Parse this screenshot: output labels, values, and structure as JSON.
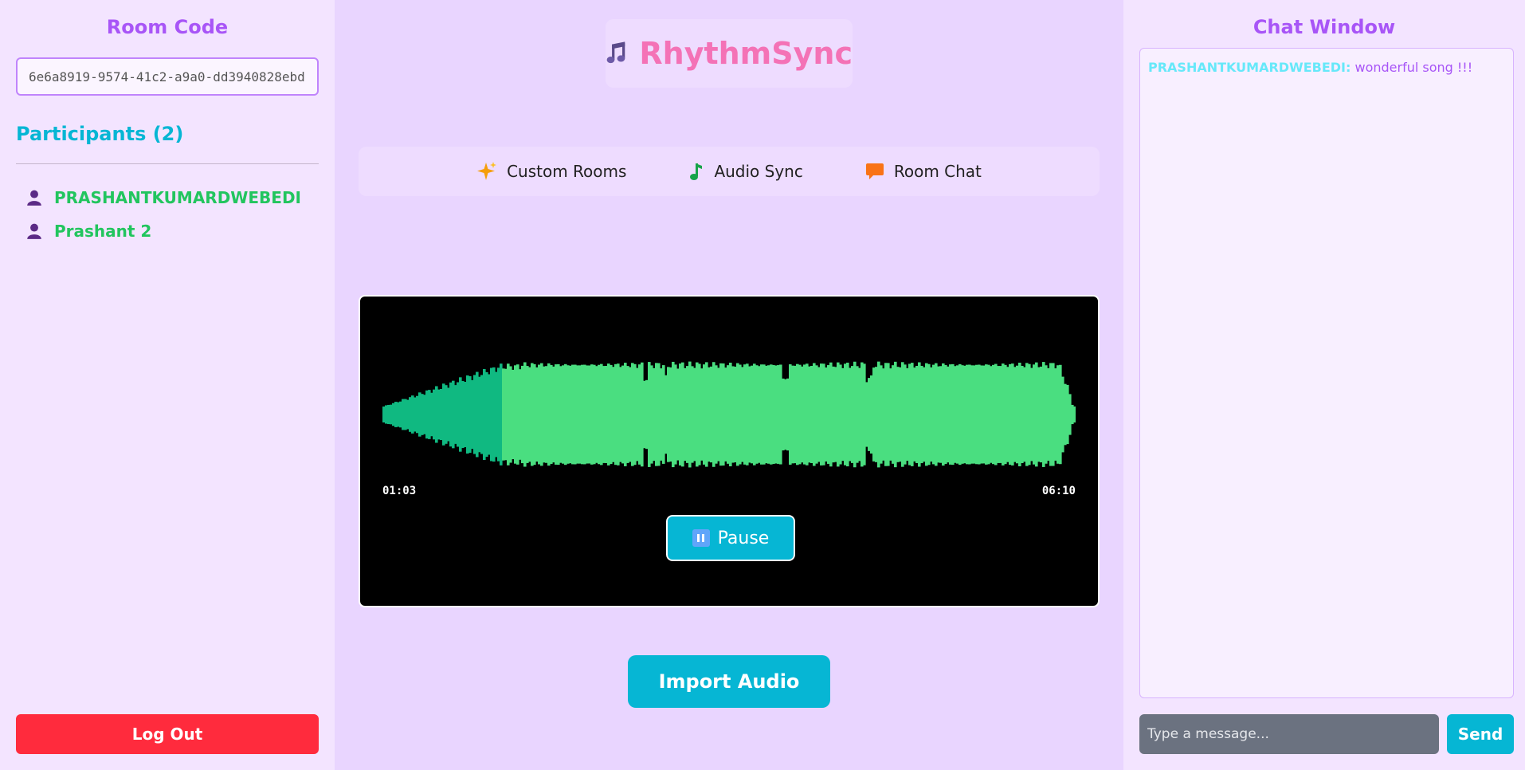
{
  "sidebar": {
    "room_code_title": "Room Code",
    "room_code_value": "6e6a8919-9574-41c2-a9a0-dd3940828ebd",
    "participants_title": "Participants (2)",
    "participants": [
      {
        "name": "PRASHANTKUMARDWEBEDI"
      },
      {
        "name": "Prashant 2"
      }
    ],
    "logout_label": "Log Out"
  },
  "header": {
    "brand": "RhythmSync",
    "features": [
      {
        "label": "Custom Rooms",
        "icon": "sparkles-icon"
      },
      {
        "label": "Audio Sync",
        "icon": "music-note-icon"
      },
      {
        "label": "Room Chat",
        "icon": "chat-bubble-icon"
      }
    ]
  },
  "player": {
    "current_time": "01:03",
    "duration": "06:10",
    "progress": 0.17,
    "pause_label": "Pause"
  },
  "import_label": "Import Audio",
  "chat": {
    "title": "Chat Window",
    "messages": [
      {
        "author": "PRASHANTKUMARDWEBEDI:",
        "text": "wonderful song !!!"
      }
    ],
    "input_placeholder": "Type a message...",
    "send_label": "Send"
  },
  "colors": {
    "accent_purple": "#a855f7",
    "accent_cyan": "#06b6d4",
    "participant_green": "#22c55e",
    "brand_pink": "#f472b6",
    "wave_played": "#10b981",
    "wave_unplayed": "#4ade80",
    "logout_red": "#ff2b3d"
  }
}
